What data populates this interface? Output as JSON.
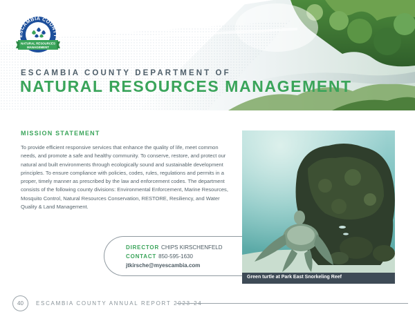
{
  "logo": {
    "ring_text": "ESCAMBIA COUNTY",
    "banner_line1": "NATURAL RESOURCES",
    "banner_line2": "MANAGEMENT",
    "colors": {
      "blue": "#1d4f9b",
      "green": "#3aa45a"
    }
  },
  "header": {
    "dept_line": "ESCAMBIA COUNTY DEPARTMENT OF",
    "dept_title": "NATURAL RESOURCES MANAGEMENT"
  },
  "mission": {
    "heading": "MISSION STATEMENT",
    "body": "To provide efficient responsive services that enhance the quality of life, meet common needs, and promote a safe and healthy community. To conserve, restore, and protect our natural and built environments through ecologically sound and sustainable development principles. To ensure compliance with policies, codes, rules, regulations and permits in a proper, timely manner as prescribed by the law and enforcement codes. The department consists of the following county divisions: Environmental Enforcement, Marine Resources, Mosquito Control, Natural Resources Conservation, RESTORE, Resiliency, and Water Quality & Land Management."
  },
  "contact": {
    "director_label": "DIRECTOR",
    "director_name": "CHIPS KIRSCHENFELD",
    "contact_label": "CONTACT",
    "phone": "850-595-1630",
    "email": "jtkirsche@myescambia.com"
  },
  "photo": {
    "caption": "Green turtle at Park East Snorkeling Reef"
  },
  "footer": {
    "page_number": "40",
    "text": "ESCAMBIA COUNTY ANNUAL REPORT 2023-24"
  },
  "colors": {
    "accent_green": "#3aa45a",
    "heading_gray": "#4f5f6a",
    "caption_bar": "#3e4b56"
  }
}
